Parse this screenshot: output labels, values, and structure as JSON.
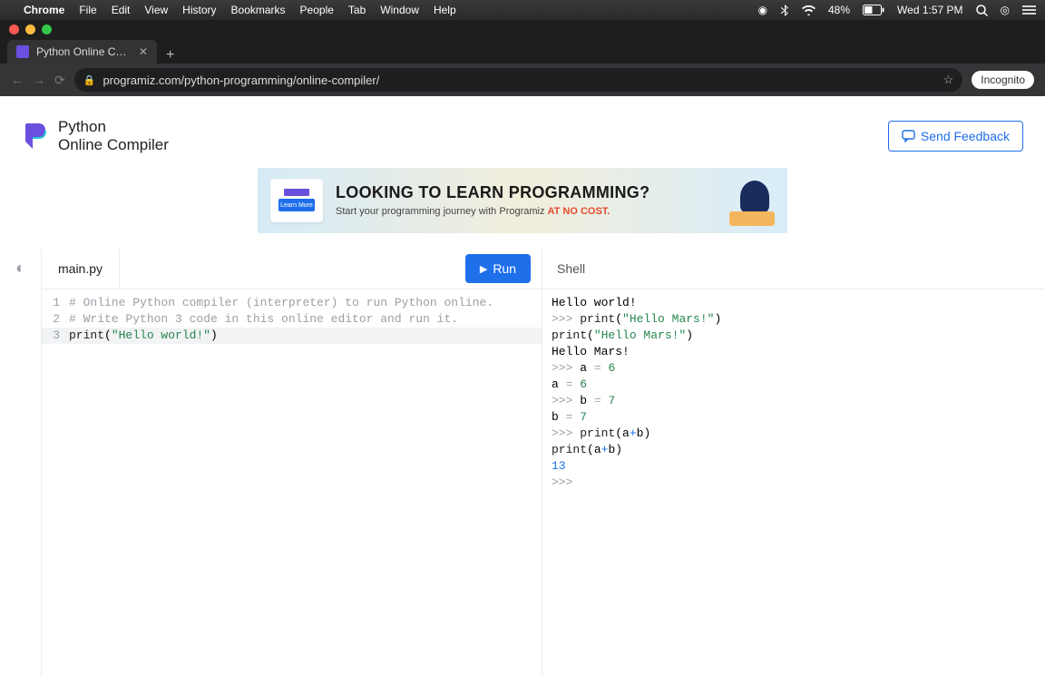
{
  "menubar": {
    "app_name": "Chrome",
    "items": [
      "File",
      "Edit",
      "View",
      "History",
      "Bookmarks",
      "People",
      "Tab",
      "Window",
      "Help"
    ],
    "battery": "48%",
    "clock": "Wed 1:57 PM"
  },
  "browser": {
    "tab_title": "Python Online Compiler (Interp",
    "url": "programiz.com/python-programming/online-compiler/",
    "incognito_label": "Incognito"
  },
  "brand": {
    "line1": "Python",
    "line2": "Online Compiler"
  },
  "feedback": {
    "label": "Send Feedback"
  },
  "banner": {
    "title": "LOOKING TO LEARN PROGRAMMING?",
    "sub_prefix": "Start your programming journey with Programiz ",
    "sub_accent": "AT NO COST.",
    "card_btn": "Learn More"
  },
  "editor": {
    "tab_label": "main.py",
    "run_label": "Run",
    "lines": [
      {
        "n": "1",
        "comment": "# Online Python compiler (interpreter) to run Python online."
      },
      {
        "n": "2",
        "comment": "# Write Python 3 code in this online editor and run it."
      },
      {
        "n": "3",
        "func": "print",
        "lparen": "(",
        "string": "\"Hello world!\"",
        "rparen": ")"
      }
    ]
  },
  "shell": {
    "header": "Shell",
    "lines": [
      {
        "type": "out",
        "text": "Hello world!"
      },
      {
        "type": "in",
        "func": "print",
        "lparen": "(",
        "string": "\"Hello Mars!\"",
        "rparen": ")"
      },
      {
        "type": "echo",
        "func": "print",
        "lparen": "(",
        "string": "\"Hello Mars!\"",
        "rparen": ")"
      },
      {
        "type": "out",
        "text": "Hello Mars!"
      },
      {
        "type": "in",
        "var": "a",
        "eq": " = ",
        "num": "6"
      },
      {
        "type": "echo",
        "var": "a",
        "eq": " = ",
        "num": "6"
      },
      {
        "type": "in",
        "var": "b",
        "eq": " = ",
        "num": "7"
      },
      {
        "type": "echo",
        "var": "b",
        "eq": " = ",
        "num": "7"
      },
      {
        "type": "in",
        "func": "print",
        "lparen": "(",
        "exprA": "a",
        "op": "+",
        "exprB": "b",
        "rparen": ")"
      },
      {
        "type": "echo",
        "func": "print",
        "lparen": "(",
        "exprA": "a",
        "op": "+",
        "exprB": "b",
        "rparen": ")"
      },
      {
        "type": "result",
        "text": "13"
      },
      {
        "type": "prompt"
      }
    ],
    "prompt": ">>> "
  }
}
